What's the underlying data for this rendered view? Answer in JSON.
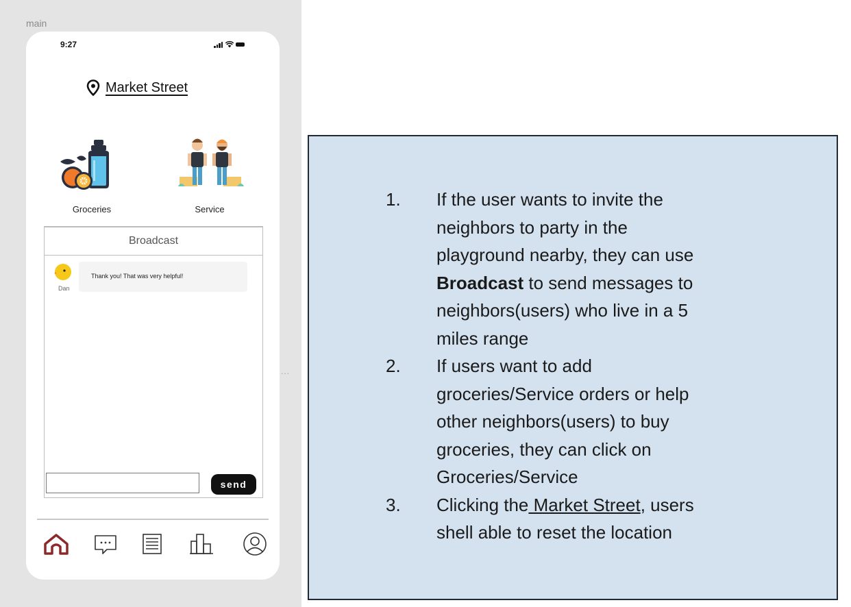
{
  "frame": {
    "label": "main",
    "more_indicator": "..."
  },
  "status_bar": {
    "time": "9:27"
  },
  "location": {
    "label": "Market Street"
  },
  "categories": [
    {
      "label": "Groceries",
      "icon": "groceries-icon"
    },
    {
      "label": "Service",
      "icon": "service-workers-icon"
    }
  ],
  "broadcast": {
    "title": "Broadcast",
    "messages": [
      {
        "author": "Dan",
        "text": "Thank you! That was very helpful!"
      }
    ],
    "input": {
      "value": "",
      "placeholder": ""
    },
    "send_label": "send"
  },
  "bottom_nav": [
    {
      "name": "home",
      "icon": "home-icon",
      "active": true
    },
    {
      "name": "messages",
      "icon": "chat-icon",
      "active": false
    },
    {
      "name": "orders",
      "icon": "list-icon",
      "active": false
    },
    {
      "name": "stats",
      "icon": "bar-chart-icon",
      "active": false
    },
    {
      "name": "profile",
      "icon": "user-icon",
      "active": false
    }
  ],
  "colors": {
    "accent": "#8b2a2a",
    "send_button": "#111111",
    "note_background": "#d4e2f0"
  },
  "annotation": {
    "items": [
      {
        "number": "1.",
        "pre": "If the user wants to invite the neighbors to party in the playground nearby, they can use ",
        "bold": "Broadcast",
        "post": " to send messages to neighbors(users) who live in a 5 miles range"
      },
      {
        "number": "2.",
        "text": "If users want to add groceries/Service orders or help other neighbors(users) to buy groceries, they can click on Groceries/Service"
      },
      {
        "number": "3.",
        "pre": "Clicking the",
        "link": " Market Street",
        "post": ",   users shell able to reset the location"
      }
    ]
  }
}
